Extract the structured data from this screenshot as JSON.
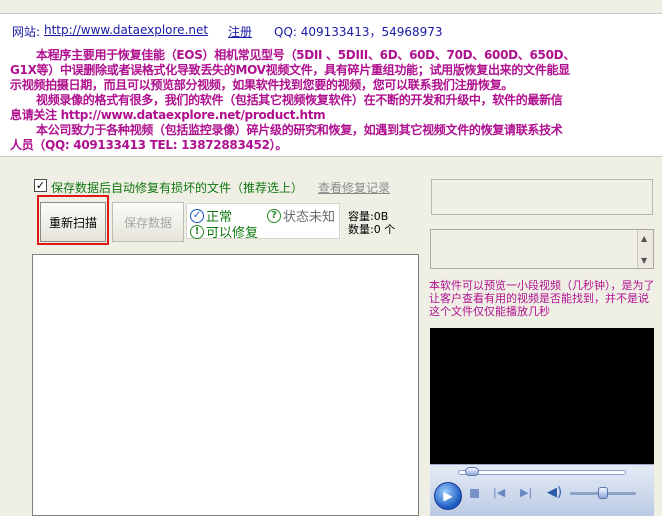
{
  "header": {
    "website_label": "网站:",
    "website_url": "http://www.dataexplore.net",
    "register_label": "注册",
    "qq_text": "QQ: 409133413，54968973"
  },
  "description": {
    "lines": [
      "本程序主要用于恢复佳能（EOS）相机常见型号（5DII 、5DIII、6D、60D、70D、600D、650D、",
      "G1X等）中误删除或者误格式化导致丢失的MOV视频文件，具有碎片重组功能；试用版恢复出来的文件能显",
      "示视频拍摄日期，而且可以预览部分视频，如果软件找到您要的视频，您可以联系我们注册恢复。",
      "视频录像的格式有很多，我们的软件（包括其它视频恢复软件）在不断的开发和升级中，软件的最新信",
      "息请关注 http://www.dataexplore.net/product.htm",
      "本公司致力于各种视频（包括监控录像）碎片级的研究和恢复，如遇到其它视频文件的恢复请联系技术",
      "人员（QQ: 409133413  TEL: 13872883452）。"
    ]
  },
  "options": {
    "auto_repair_checked": "✓",
    "auto_repair_label": "保存数据后自动修复有损坏的文件（推荐选上）",
    "view_log_label": "查看修复记录"
  },
  "toolbar": {
    "rescan_label": "重新扫描",
    "save_data_label": "保存数据"
  },
  "legend": {
    "normal_label": "正常",
    "unknown_label": "状态未知",
    "repairable_label": "可以修复"
  },
  "stats": {
    "capacity": "容量:0B",
    "count": "数量:0 个"
  },
  "preview": {
    "note": "本软件可以预览一小段视频（几秒钟），是为了让客户查看有用的视频是否能找到，并不是说这个文件仅仅能播放几秒"
  },
  "player": {
    "seek_fraction": 0.04,
    "volume_fraction": 0.5
  },
  "colors": {
    "accent_text": "#b0108f",
    "link": "#1a1aa6",
    "highlight_border": "#e01818",
    "status_green": "#107810"
  }
}
